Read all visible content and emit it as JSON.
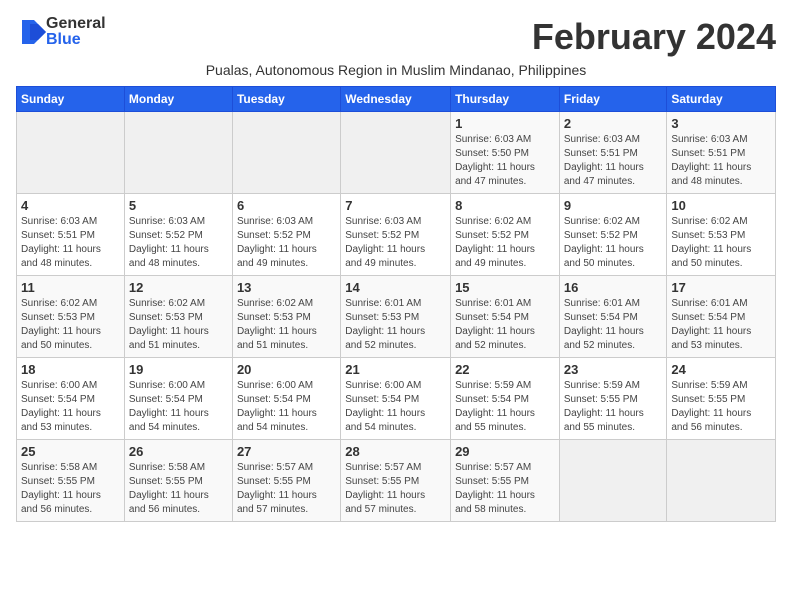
{
  "logo": {
    "general": "General",
    "blue": "Blue"
  },
  "title": "February 2024",
  "subtitle": "Pualas, Autonomous Region in Muslim Mindanao, Philippines",
  "weekdays": [
    "Sunday",
    "Monday",
    "Tuesday",
    "Wednesday",
    "Thursday",
    "Friday",
    "Saturday"
  ],
  "weeks": [
    [
      {
        "num": "",
        "info": ""
      },
      {
        "num": "",
        "info": ""
      },
      {
        "num": "",
        "info": ""
      },
      {
        "num": "",
        "info": ""
      },
      {
        "num": "1",
        "info": "Sunrise: 6:03 AM\nSunset: 5:50 PM\nDaylight: 11 hours\nand 47 minutes."
      },
      {
        "num": "2",
        "info": "Sunrise: 6:03 AM\nSunset: 5:51 PM\nDaylight: 11 hours\nand 47 minutes."
      },
      {
        "num": "3",
        "info": "Sunrise: 6:03 AM\nSunset: 5:51 PM\nDaylight: 11 hours\nand 48 minutes."
      }
    ],
    [
      {
        "num": "4",
        "info": "Sunrise: 6:03 AM\nSunset: 5:51 PM\nDaylight: 11 hours\nand 48 minutes."
      },
      {
        "num": "5",
        "info": "Sunrise: 6:03 AM\nSunset: 5:52 PM\nDaylight: 11 hours\nand 48 minutes."
      },
      {
        "num": "6",
        "info": "Sunrise: 6:03 AM\nSunset: 5:52 PM\nDaylight: 11 hours\nand 49 minutes."
      },
      {
        "num": "7",
        "info": "Sunrise: 6:03 AM\nSunset: 5:52 PM\nDaylight: 11 hours\nand 49 minutes."
      },
      {
        "num": "8",
        "info": "Sunrise: 6:02 AM\nSunset: 5:52 PM\nDaylight: 11 hours\nand 49 minutes."
      },
      {
        "num": "9",
        "info": "Sunrise: 6:02 AM\nSunset: 5:52 PM\nDaylight: 11 hours\nand 50 minutes."
      },
      {
        "num": "10",
        "info": "Sunrise: 6:02 AM\nSunset: 5:53 PM\nDaylight: 11 hours\nand 50 minutes."
      }
    ],
    [
      {
        "num": "11",
        "info": "Sunrise: 6:02 AM\nSunset: 5:53 PM\nDaylight: 11 hours\nand 50 minutes."
      },
      {
        "num": "12",
        "info": "Sunrise: 6:02 AM\nSunset: 5:53 PM\nDaylight: 11 hours\nand 51 minutes."
      },
      {
        "num": "13",
        "info": "Sunrise: 6:02 AM\nSunset: 5:53 PM\nDaylight: 11 hours\nand 51 minutes."
      },
      {
        "num": "14",
        "info": "Sunrise: 6:01 AM\nSunset: 5:53 PM\nDaylight: 11 hours\nand 52 minutes."
      },
      {
        "num": "15",
        "info": "Sunrise: 6:01 AM\nSunset: 5:54 PM\nDaylight: 11 hours\nand 52 minutes."
      },
      {
        "num": "16",
        "info": "Sunrise: 6:01 AM\nSunset: 5:54 PM\nDaylight: 11 hours\nand 52 minutes."
      },
      {
        "num": "17",
        "info": "Sunrise: 6:01 AM\nSunset: 5:54 PM\nDaylight: 11 hours\nand 53 minutes."
      }
    ],
    [
      {
        "num": "18",
        "info": "Sunrise: 6:00 AM\nSunset: 5:54 PM\nDaylight: 11 hours\nand 53 minutes."
      },
      {
        "num": "19",
        "info": "Sunrise: 6:00 AM\nSunset: 5:54 PM\nDaylight: 11 hours\nand 54 minutes."
      },
      {
        "num": "20",
        "info": "Sunrise: 6:00 AM\nSunset: 5:54 PM\nDaylight: 11 hours\nand 54 minutes."
      },
      {
        "num": "21",
        "info": "Sunrise: 6:00 AM\nSunset: 5:54 PM\nDaylight: 11 hours\nand 54 minutes."
      },
      {
        "num": "22",
        "info": "Sunrise: 5:59 AM\nSunset: 5:54 PM\nDaylight: 11 hours\nand 55 minutes."
      },
      {
        "num": "23",
        "info": "Sunrise: 5:59 AM\nSunset: 5:55 PM\nDaylight: 11 hours\nand 55 minutes."
      },
      {
        "num": "24",
        "info": "Sunrise: 5:59 AM\nSunset: 5:55 PM\nDaylight: 11 hours\nand 56 minutes."
      }
    ],
    [
      {
        "num": "25",
        "info": "Sunrise: 5:58 AM\nSunset: 5:55 PM\nDaylight: 11 hours\nand 56 minutes."
      },
      {
        "num": "26",
        "info": "Sunrise: 5:58 AM\nSunset: 5:55 PM\nDaylight: 11 hours\nand 56 minutes."
      },
      {
        "num": "27",
        "info": "Sunrise: 5:57 AM\nSunset: 5:55 PM\nDaylight: 11 hours\nand 57 minutes."
      },
      {
        "num": "28",
        "info": "Sunrise: 5:57 AM\nSunset: 5:55 PM\nDaylight: 11 hours\nand 57 minutes."
      },
      {
        "num": "29",
        "info": "Sunrise: 5:57 AM\nSunset: 5:55 PM\nDaylight: 11 hours\nand 58 minutes."
      },
      {
        "num": "",
        "info": ""
      },
      {
        "num": "",
        "info": ""
      }
    ]
  ]
}
